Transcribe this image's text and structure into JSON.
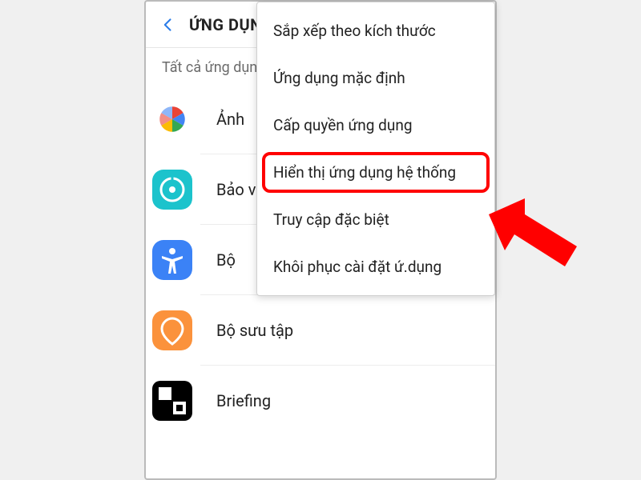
{
  "header": {
    "title": "ỨNG DỤNG"
  },
  "filter": {
    "label": "Tất cả ứng dụng"
  },
  "apps": [
    {
      "label": "Ảnh",
      "icon": "photos-icon"
    },
    {
      "label": "Bảo vệ",
      "icon": "protect-icon"
    },
    {
      "label": "Bộ",
      "icon": "accessibility-icon"
    },
    {
      "label": "Bộ sưu tập",
      "icon": "gallery-icon"
    },
    {
      "label": "Briefing",
      "icon": "briefing-icon"
    }
  ],
  "menu": {
    "items": [
      {
        "label": "Sắp xếp theo kích thước"
      },
      {
        "label": "Ứng dụng mặc định"
      },
      {
        "label": "Cấp quyền ứng dụng"
      },
      {
        "label": "Hiển thị ứng dụng hệ thống",
        "highlighted": true
      },
      {
        "label": "Truy cập đặc biệt"
      },
      {
        "label": "Khôi phục cài đặt ứ.dụng"
      }
    ]
  },
  "annotation": {
    "arrow_color": "#ff0000",
    "highlight_color": "#ff0000"
  }
}
